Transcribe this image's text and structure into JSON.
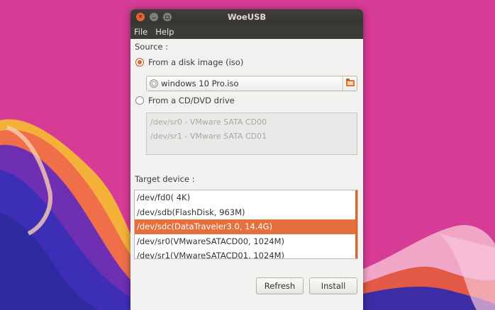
{
  "window": {
    "title": "WoeUSB",
    "controls": [
      "close-icon",
      "minimize-icon",
      "maximize-icon"
    ]
  },
  "menu": [
    {
      "label": "File"
    },
    {
      "label": "Help"
    }
  ],
  "source": {
    "label": "Source :",
    "iso_option": {
      "label": "From a disk image (iso)",
      "selected": true
    },
    "iso_file": "windows 10 Pro.iso",
    "cd_option": {
      "label": "From a CD/DVD drive",
      "selected": false
    },
    "cd_drives": [
      "/dev/sr0 - VMware SATA CD00",
      "/dev/sr1 - VMware SATA CD01"
    ]
  },
  "target": {
    "label": "Target device :",
    "devices": [
      {
        "label": "/dev/fd0(  4K)"
      },
      {
        "label": "/dev/sdb(FlashDisk,  963M)"
      },
      {
        "label": "/dev/sdc(DataTraveler3.0, 14.4G)",
        "selected": true
      },
      {
        "label": "/dev/sr0(VMwareSATACD00, 1024M)"
      },
      {
        "label": "/dev/sr1(VMwareSATACD01, 1024M)"
      }
    ]
  },
  "buttons": {
    "refresh": "Refresh",
    "install": "Install"
  },
  "colors": {
    "accent": "#e4703e",
    "titlebar": "#3c3b37",
    "window_bg": "#f2f1f0",
    "wallpaper": "#d63b96"
  }
}
